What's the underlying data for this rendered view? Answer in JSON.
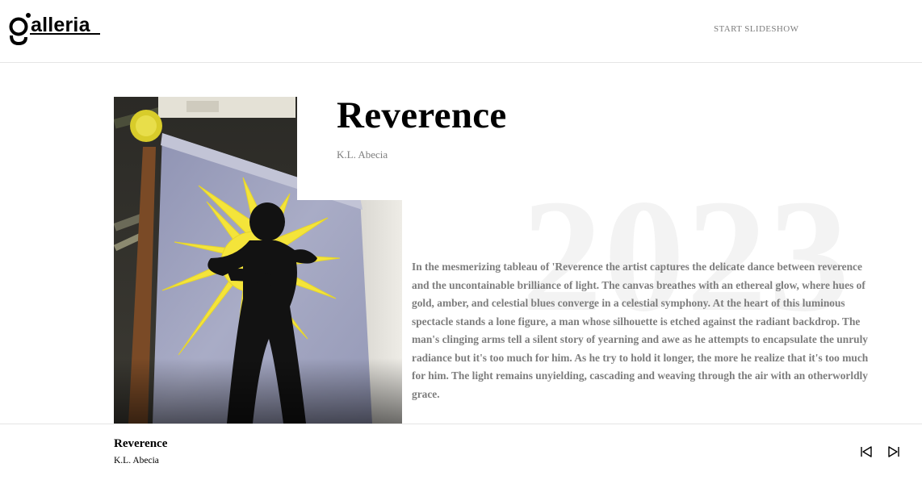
{
  "header": {
    "logo_text": "alleria",
    "slideshow_label": "START SLIDESHOW"
  },
  "artwork": {
    "title": "Reverence",
    "artist": "K.L. Abecia",
    "year": "2023",
    "description": "In the mesmerizing tableau of 'Reverence the artist captures the delicate dance between reverence and the uncontainable brilliance of light. The canvas breathes with an ethereal glow, where hues of gold, amber, and celestial blues converge in a celestial symphony. At the heart of this luminous spectacle stands a lone figure, a man whose silhouette is etched against the radiant backdrop. The man's clinging arms tell a silent story of yearning and awe as he attempts to encapsulate the unruly radiance but it's too much for him. As he try to hold it longer, the more he realize that it's too much for him. The light remains unyielding, cascading and weaving through the air with an otherworldly grace."
  },
  "footer": {
    "title": "Reverence",
    "artist": "K.L. Abecia"
  },
  "icons": {
    "prev": "skip-previous-icon",
    "next": "skip-next-icon"
  }
}
